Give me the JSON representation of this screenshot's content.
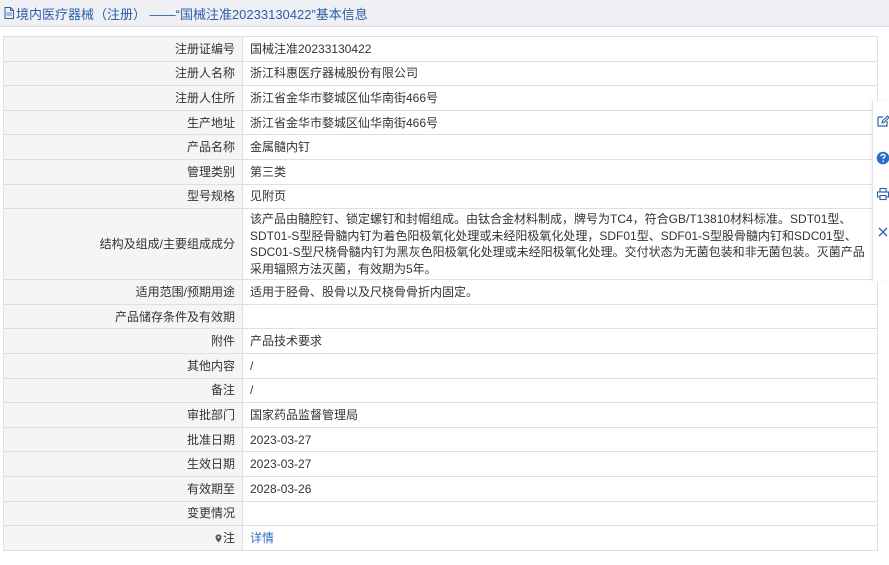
{
  "header": {
    "title": "境内医疗器械（注册） ——“国械注准20233130422”基本信息",
    "icon": "document-icon"
  },
  "rows": [
    {
      "label": "注册证编号",
      "value": "国械注准20233130422"
    },
    {
      "label": "注册人名称",
      "value": "浙江科惠医疗器械股份有限公司"
    },
    {
      "label": "注册人住所",
      "value": "浙江省金华市婺城区仙华南街466号"
    },
    {
      "label": "生产地址",
      "value": "浙江省金华市婺城区仙华南街466号"
    },
    {
      "label": "产品名称",
      "value": "金属髓内钉"
    },
    {
      "label": "管理类别",
      "value": "第三类"
    },
    {
      "label": "型号规格",
      "value": "见附页"
    },
    {
      "label": "结构及组成/主要组成成分",
      "value": "该产品由髓腔钉、锁定螺钉和封帽组成。由钛合金材料制成，牌号为TC4，符合GB/T13810材料标准。SDT01型、SDT01-S型胫骨髓内钉为着色阳极氧化处理或未经阳极氧化处理，SDF01型、SDF01-S型股骨髓内钉和SDC01型、SDC01-S型尺桡骨髓内钉为黑灰色阳极氧化处理或未经阳极氧化处理。交付状态为无菌包装和非无菌包装。灭菌产品采用辐照方法灭菌，有效期为5年。"
    },
    {
      "label": "适用范围/预期用途",
      "value": "适用于胫骨、股骨以及尺桡骨骨折内固定。"
    },
    {
      "label": "产品储存条件及有效期",
      "value": ""
    },
    {
      "label": "附件",
      "value": "产品技术要求"
    },
    {
      "label": "其他内容",
      "value": "/"
    },
    {
      "label": "备注",
      "value": "/"
    },
    {
      "label": "审批部门",
      "value": "国家药品监督管理局"
    },
    {
      "label": "批准日期",
      "value": "2023-03-27"
    },
    {
      "label": "生效日期",
      "value": "2023-03-27"
    },
    {
      "label": "有效期至",
      "value": "2028-03-26"
    },
    {
      "label": "变更情况",
      "value": ""
    }
  ],
  "note": {
    "label": "注",
    "link": "详情",
    "icon": "map-pin-icon"
  },
  "side_tools": [
    {
      "icon": "edit-icon"
    },
    {
      "icon": "help-icon"
    },
    {
      "icon": "print-icon"
    },
    {
      "icon": "close-icon"
    }
  ],
  "colors": {
    "header_bg": "#eef0f3",
    "title": "#2d5fa6",
    "label_bg": "#f4f5f7",
    "border": "#dcdfe4",
    "link": "#2d6fc4"
  }
}
